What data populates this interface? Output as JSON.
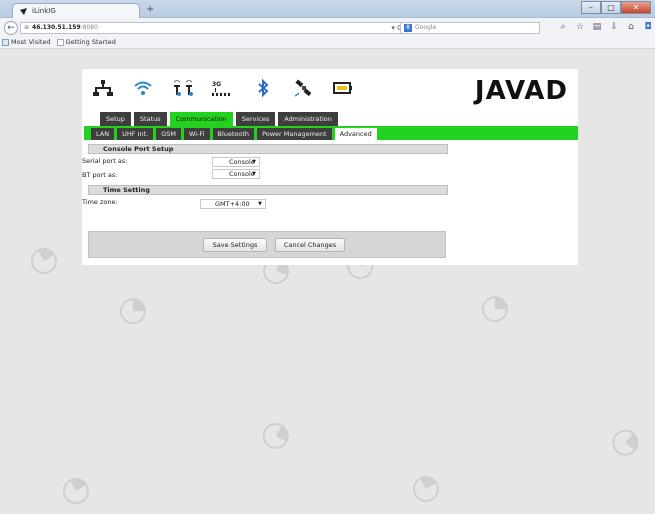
{
  "browser": {
    "tab_title": "iLinkIG",
    "new_tab": "+",
    "url_host": "46.130.51.159",
    "url_port": ":8080",
    "search_placeholder": "Google",
    "bookmarks": [
      "Most Visited",
      "Getting Started"
    ],
    "window_controls": [
      "–",
      "□",
      "✕"
    ]
  },
  "header": {
    "logo": "JAVAD",
    "status_icons": [
      "network-icon",
      "wifi-icon",
      "radio-antenna-icon",
      "cellular-3g-icon",
      "bluetooth-icon",
      "satellite-icon",
      "battery-icon"
    ],
    "cell_label": "3G"
  },
  "main_tabs": [
    {
      "label": "Setup",
      "active": false
    },
    {
      "label": "Status",
      "active": false
    },
    {
      "label": "Communication",
      "active": true
    },
    {
      "label": "Services",
      "active": false
    },
    {
      "label": "Administration",
      "active": false
    }
  ],
  "sub_tabs": [
    {
      "label": "LAN",
      "active": false
    },
    {
      "label": "UHF Int.",
      "active": false
    },
    {
      "label": "GSM",
      "active": false
    },
    {
      "label": "Wi-Fi",
      "active": false
    },
    {
      "label": "Bluetooth",
      "active": false
    },
    {
      "label": "Power Management",
      "active": false
    },
    {
      "label": "Advanced",
      "active": true
    }
  ],
  "console_section": {
    "title": "Console Port Setup",
    "serial_label": "Serial port as:",
    "serial_value": "Console",
    "bt_label": "BT port as:",
    "bt_value": "Console"
  },
  "time_section": {
    "title": "Time Setting",
    "zone_label": "Time zone:",
    "zone_value": "GMT+4:00"
  },
  "actions": {
    "save": "Save Settings",
    "cancel": "Cancel Changes"
  },
  "colors": {
    "accent_green": "#22d21e",
    "tab_dark": "#3e3e3e",
    "page_bg": "#e6e6e6"
  }
}
